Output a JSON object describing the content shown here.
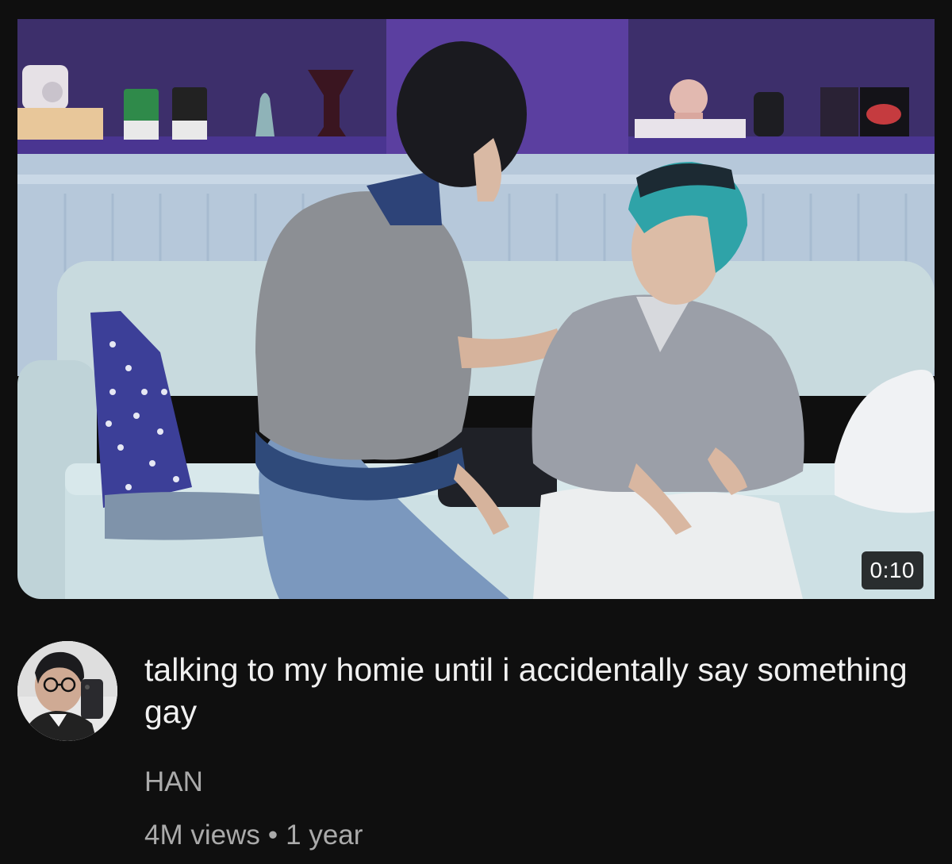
{
  "video": {
    "duration": "0:10",
    "title": "talking to my homie until i accidentally say something gay",
    "channel": "HAN",
    "views": "4M views",
    "separator": "•",
    "age": "1 year"
  },
  "colors": {
    "background": "#0f0f0f",
    "title_text": "#f1f1f1",
    "secondary_text": "#aaaaaa",
    "duration_badge": "#000000"
  },
  "icons": {
    "thumbnail": "video-thumbnail",
    "avatar": "channel-avatar"
  }
}
